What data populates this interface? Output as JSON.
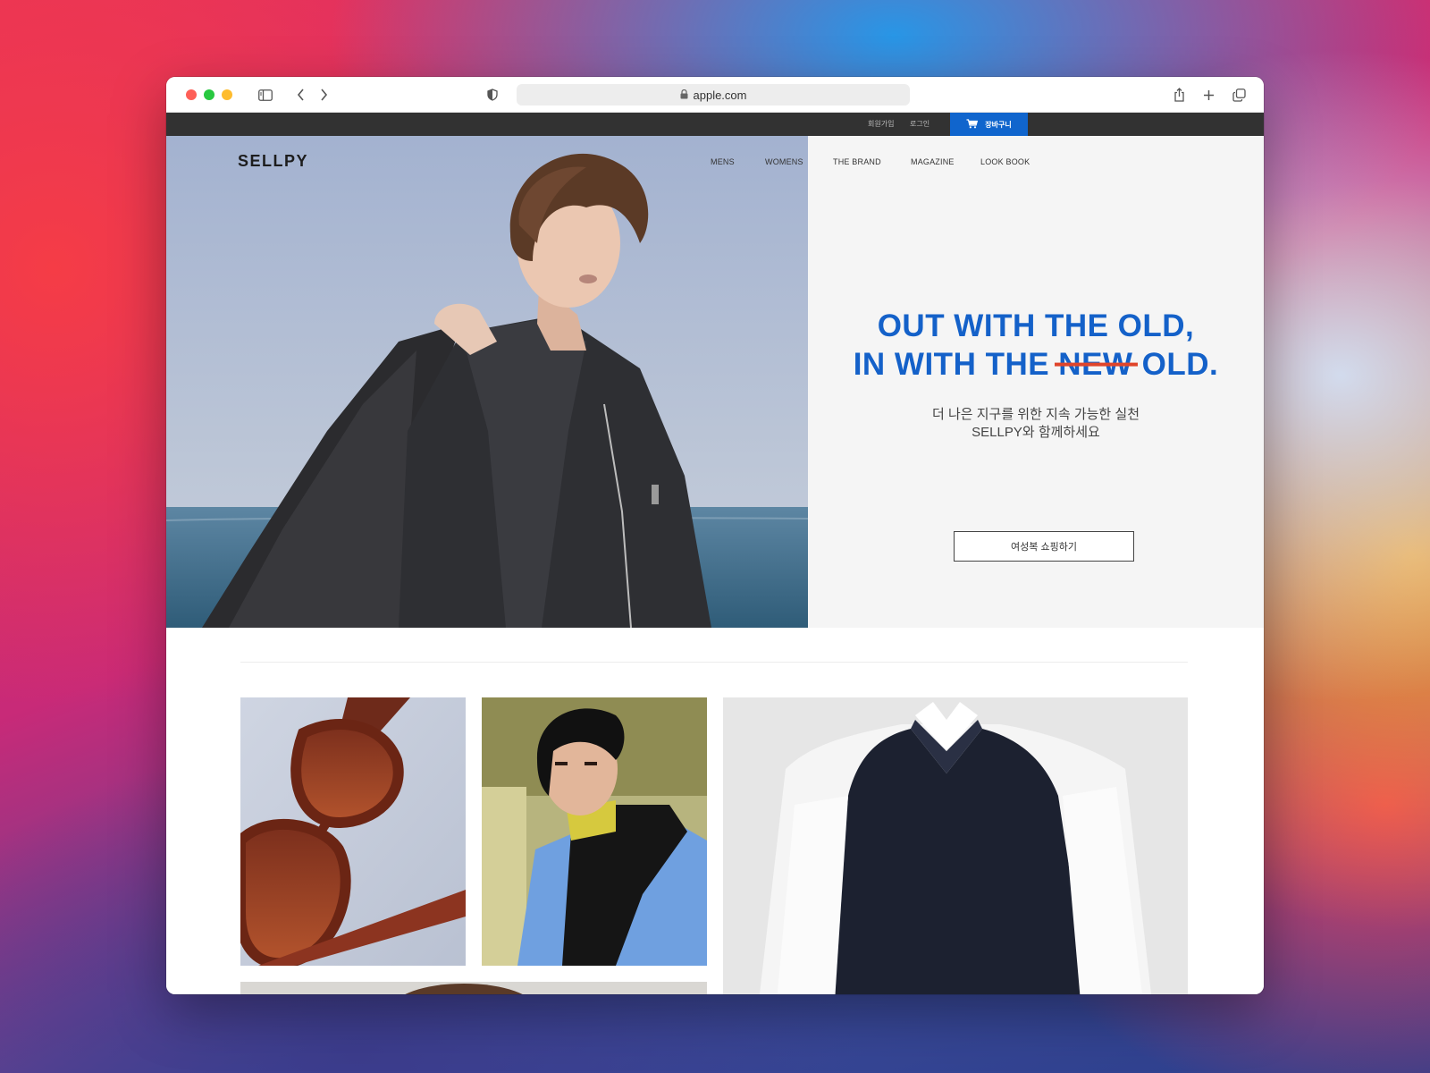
{
  "browser": {
    "url": "apple.com"
  },
  "site": {
    "top_links": [
      "회원가입",
      "로그인"
    ],
    "cart_label": "장바구니",
    "logo": "SELLPY",
    "nav": [
      "MENS",
      "WOMENS",
      "THE BRAND",
      "MAGAZINE",
      "LOOK BOOK"
    ],
    "hero": {
      "headline_line1": "OUT WITH THE OLD,",
      "headline_line2_a": "IN WITH THE ",
      "headline_line2_struck": "NEW",
      "headline_line2_b": " OLD.",
      "subcopy_line1": "더 나은 지구를 위한 지속 가능한 실천",
      "subcopy_line2": "SELLPY와 함께하세요",
      "cta": "여성복 쇼핑하기"
    }
  },
  "colors": {
    "accent_blue": "#1461c9",
    "cart_blue": "#1065cd",
    "strike_red": "#e0452b",
    "topbar": "#323232"
  }
}
